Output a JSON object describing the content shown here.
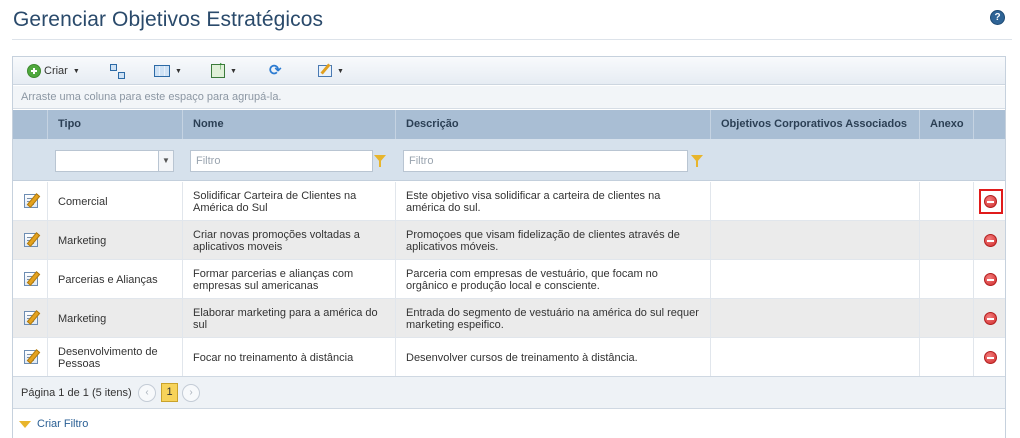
{
  "page": {
    "title": "Gerenciar Objetivos Estratégicos",
    "help_icon": "?"
  },
  "toolbar": {
    "create_label": "Criar",
    "icons": [
      "plus-icon",
      "hierarchy-icon",
      "columns-icon",
      "export-icon",
      "refresh-icon",
      "edit-icon"
    ]
  },
  "group_hint": "Arraste uma coluna para este espaço para agrupá-la.",
  "columns": {
    "tipo": "Tipo",
    "nome": "Nome",
    "descricao": "Descrição",
    "objetivos": "Objetivos Corporativos Associados",
    "anexo": "Anexo"
  },
  "filters": {
    "tipo_value": "",
    "nome_placeholder": "Filtro",
    "descricao_placeholder": "Filtro"
  },
  "rows": [
    {
      "tipo": "Comercial",
      "nome": "Solidificar Carteira de Clientes na América do Sul",
      "descricao": "Este objetivo visa solidificar a carteira de clientes na américa do sul.",
      "objetivos": "",
      "anexo": ""
    },
    {
      "tipo": "Marketing",
      "nome": "Criar novas promoções voltadas a aplicativos moveis",
      "descricao": "Promoçoes que visam fidelização de clientes através de aplicativos móveis.",
      "objetivos": "",
      "anexo": ""
    },
    {
      "tipo": "Parcerias e Alianças",
      "nome": "Formar parcerias e alianças com empresas sul americanas",
      "descricao": "Parceria com empresas de vestuário, que focam no orgânico e produção local e consciente.",
      "objetivos": "",
      "anexo": ""
    },
    {
      "tipo": "Marketing",
      "nome": "Elaborar marketing para a américa do sul",
      "descricao": "Entrada do segmento de vestuário na américa do sul requer marketing espeifico.",
      "objetivos": "",
      "anexo": ""
    },
    {
      "tipo": "Desenvolvimento de Pessoas",
      "nome": "Focar no treinamento à distância",
      "descricao": "Desenvolver cursos de treinamento à distância.",
      "objetivos": "",
      "anexo": ""
    }
  ],
  "pager": {
    "summary": "Página 1 de 1 (5 itens)",
    "prev": "‹",
    "current": "1",
    "next": "›"
  },
  "footer": {
    "create_filter": "Criar Filtro"
  },
  "colors": {
    "title": "#2a4a6b",
    "header_bg": "#a9bed4",
    "highlight": "#e01b1b",
    "page_active": "#f7d35a"
  }
}
